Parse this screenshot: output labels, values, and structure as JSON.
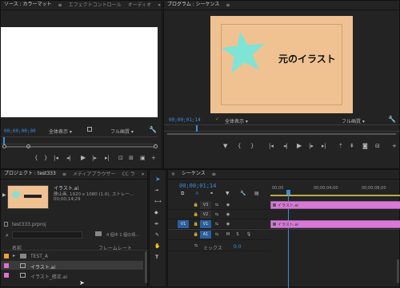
{
  "source_monitor": {
    "tabs": [
      "ソース : カラーマット",
      "エフェクトコントロール",
      "オーディオ"
    ],
    "timecode": "00;00;00;00",
    "fit_label": "全体表示",
    "quality_label": "フル画質"
  },
  "program_monitor": {
    "tab": "プログラム : シーケンス",
    "timecode": "00;00;01;14",
    "fit_label": "全体表示",
    "quality_label": "フル画質",
    "frame_text": "元のイラスト",
    "colors": {
      "frame_bg": "#f0c292",
      "star": "#7fe3d6"
    }
  },
  "project": {
    "tabs": [
      "プロジェクト : test333",
      "メディアブラウザー",
      "CC ラ"
    ],
    "preview": {
      "name": "イラスト.ai",
      "line1": "静止画, 1920 x 1080 (1.0), ストレー...",
      "line2": "00;00;14;29"
    },
    "project_file": "test333.prproj",
    "item_count": "4 個中 1 個の項...",
    "columns": {
      "name": "名前",
      "framerate": "フレームレート"
    },
    "items": [
      {
        "label": "TEST_A",
        "color": "#f0a030",
        "kind": "bin"
      },
      {
        "label": "イラスト.ai",
        "color": "#e070d0",
        "kind": "file"
      },
      {
        "label": "イラスト_修正.ai",
        "color": "#e070d0",
        "kind": "file"
      }
    ]
  },
  "sequence": {
    "tab": "シーケンス",
    "timecode": "00;00;01;14",
    "ruler": [
      "00;00",
      "00;00;04;00",
      "00;00;08;00"
    ],
    "tracks": {
      "v3": "V3",
      "v2": "V2",
      "v1": "V1",
      "v1_source": "V1",
      "a1": "A1",
      "m": "M",
      "s": "S"
    },
    "mix_label": "ミックス",
    "mix_value": "0.0",
    "clips": [
      {
        "label": "イラスト.ai",
        "track": "V3"
      },
      {
        "label": "イラスト.ai",
        "track": "V1"
      }
    ],
    "clip_color": "#d67ad6"
  }
}
